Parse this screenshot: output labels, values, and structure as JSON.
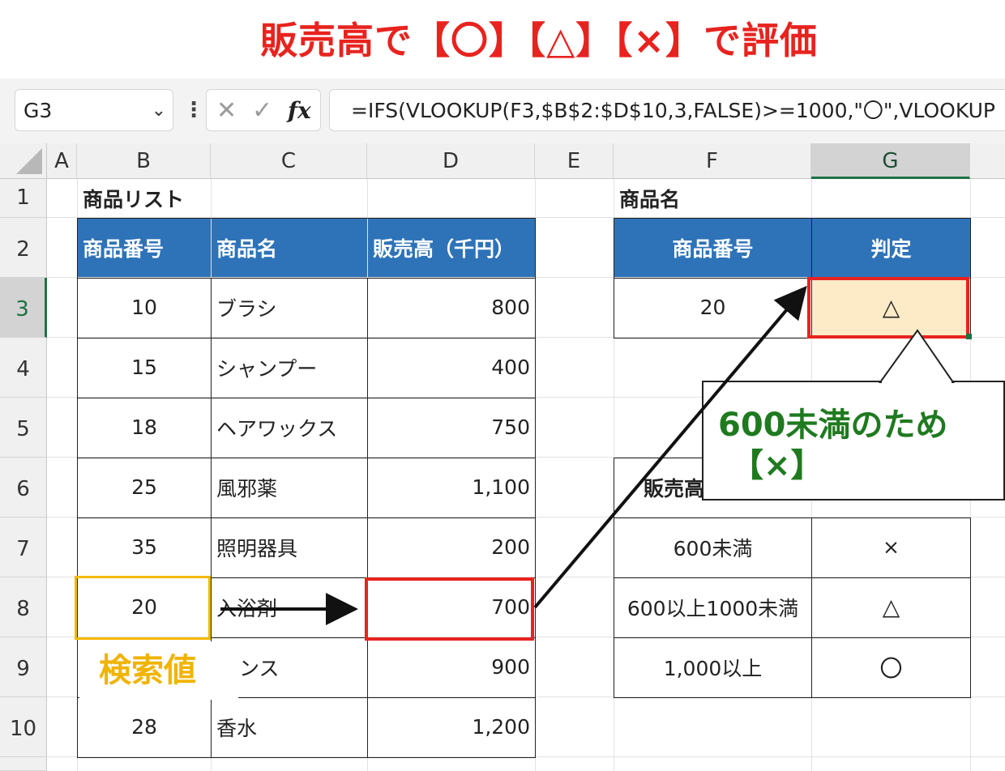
{
  "title": "販売高で【〇】【△】【×】で評価",
  "formula_bar": {
    "name_box": "G3",
    "chevron": "⌄",
    "more": "⋮",
    "cancel": "✕",
    "enter": "✓",
    "fx": "fx",
    "formula": "=IFS(VLOOKUP(F3,$B$2:$D$10,3,FALSE)>=1000,\"〇\",VLOOKUP"
  },
  "columns": [
    "A",
    "B",
    "C",
    "D",
    "E",
    "F",
    "G"
  ],
  "rows": [
    "1",
    "2",
    "3",
    "4",
    "5",
    "6",
    "7",
    "8",
    "9",
    "10"
  ],
  "product_list": {
    "title": "商品リスト",
    "headers": [
      "商品番号",
      "商品名",
      "販売高（千円）"
    ],
    "rows": [
      [
        "10",
        "ブラシ",
        "800"
      ],
      [
        "15",
        "シャンプー",
        "400"
      ],
      [
        "18",
        "ヘアワックス",
        "750"
      ],
      [
        "25",
        "風邪薬",
        "1,100"
      ],
      [
        "35",
        "照明器具",
        "200"
      ],
      [
        "20",
        "入浴剤",
        "700"
      ],
      [
        "",
        "ンス",
        "900"
      ],
      [
        "28",
        "香水",
        "1,200"
      ]
    ]
  },
  "lookup": {
    "title": "商品名",
    "headers": [
      "商品番号",
      "判定"
    ],
    "value": "20",
    "result": "△"
  },
  "criteria": {
    "header": "販売高",
    "rows": [
      [
        "600未満",
        "×"
      ],
      [
        "600以上1000未満",
        "△"
      ],
      [
        "1,000以上",
        "〇"
      ]
    ]
  },
  "callout": {
    "line1": "600未満のため",
    "line2": "【×】"
  },
  "search_label": "検索値",
  "colors": {
    "header_fill": "#2e73b8",
    "result_fill": "#fdebc8",
    "highlight_red": "#e8231f",
    "highlight_yellow": "#f5b800",
    "callout_green": "#1f7a1f"
  }
}
